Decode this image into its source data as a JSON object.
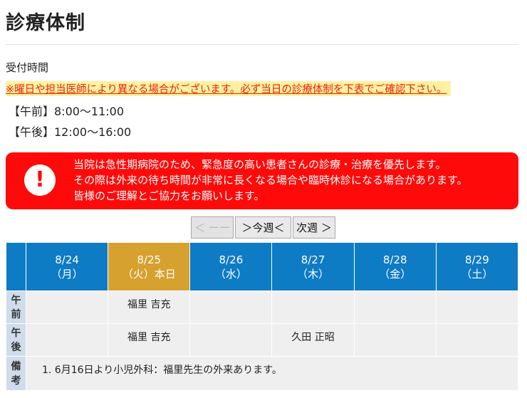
{
  "page": {
    "title": "診療体制",
    "hours_heading": "受付時間",
    "notice": "※曜日や担当医師により異なる場合がございます。必ず当日の診療体制を下表でご確認下さい。",
    "hours_am": "【午前】8:00〜11:00",
    "hours_pm": "【午後】12:00〜16:00"
  },
  "alert": {
    "icon": "exclamation-icon",
    "lines": [
      "当院は急性期病院のため、緊急度の高い患者さんの診療・治療を優先します。",
      "その際は外来の待ち時間が非常に長くなる場合や臨時休診になる場合があります。",
      "皆様のご理解とご協力をお願いします。"
    ]
  },
  "week_nav": {
    "prev": "＜ ーー",
    "this_week": "＞今週＜",
    "next": "次週 ＞"
  },
  "schedule": {
    "days": [
      {
        "date": "8/24",
        "weekday": "（月）"
      },
      {
        "date": "8/25",
        "weekday": "（火）本日"
      },
      {
        "date": "8/26",
        "weekday": "（水）"
      },
      {
        "date": "8/27",
        "weekday": "（木）"
      },
      {
        "date": "8/28",
        "weekday": "（金）"
      },
      {
        "date": "8/29",
        "weekday": "（土）"
      }
    ],
    "rows": {
      "am": {
        "label1": "午",
        "label2": "前",
        "cells": [
          "",
          "福里 吉充",
          "",
          "",
          "",
          ""
        ]
      },
      "pm": {
        "label1": "午",
        "label2": "後",
        "cells": [
          "",
          "福里 吉充",
          "",
          "久田 正昭",
          "",
          ""
        ]
      },
      "note": {
        "label1": "備",
        "label2": "考",
        "text": "1.  6月16日より小児外科：福里先生の外来あります。"
      }
    }
  },
  "colors": {
    "header_blue": "#0e7bc5",
    "today_gold": "#d7a12f",
    "alert_red": "#ff0a0a",
    "notice_red": "#e8240c",
    "notice_highlight": "#fff1a0"
  }
}
